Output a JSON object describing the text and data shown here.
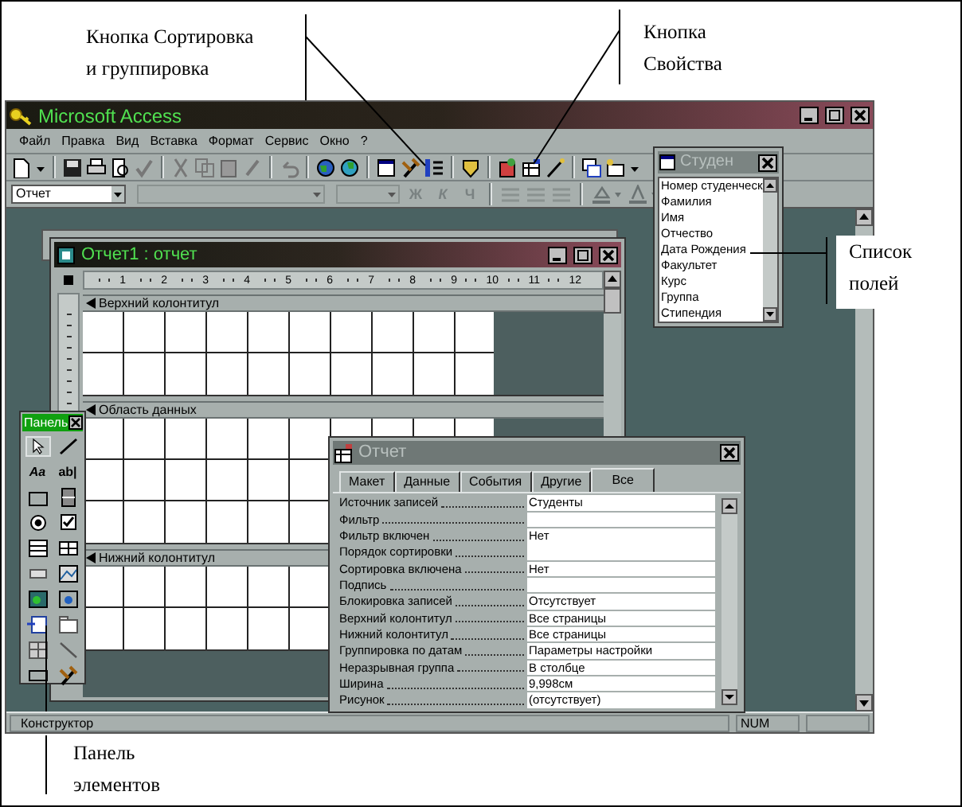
{
  "callouts": [
    {
      "lines": [
        "Кнопка Сортировка",
        "и группировка"
      ]
    },
    {
      "lines": [
        "Кнопка",
        "Свойства"
      ]
    },
    {
      "lines": [
        "Список",
        "полей"
      ]
    },
    {
      "lines": [
        "Панель",
        "элементов"
      ]
    }
  ],
  "app": {
    "title": "Microsoft Access",
    "menu": [
      "Файл",
      "Правка",
      "Вид",
      "Вставка",
      "Формат",
      "Сервис",
      "Окно",
      "?"
    ],
    "object_combo": "Отчет",
    "format_buttons": [
      "Ж",
      "К",
      "Ч"
    ],
    "status": "Конструктор",
    "indicator": "NUM"
  },
  "field_list": {
    "title": "Студен",
    "fields": [
      "Номер студенческ",
      "Фамилия",
      "Имя",
      "Отчество",
      "Дата Рождения",
      "Факультет",
      "Курс",
      "Группа",
      "Стипендия"
    ]
  },
  "report": {
    "title": "Отчет1 : отчет",
    "ruler": [
      "1",
      "2",
      "3",
      "4",
      "5",
      "6",
      "7",
      "8",
      "9",
      "10",
      "11",
      "12"
    ],
    "sections": [
      "Верхний колонтитул",
      "Область данных",
      "Нижний колонтитул"
    ]
  },
  "toolbox": {
    "title": "Панель",
    "text_tools": [
      "Aa",
      "ab|"
    ]
  },
  "properties": {
    "title": "Отчет",
    "tabs": [
      {
        "label": "Макет",
        "selected": false
      },
      {
        "label": "Данные",
        "selected": false
      },
      {
        "label": "События",
        "selected": false
      },
      {
        "label": "Другие",
        "selected": false
      },
      {
        "label": "Все",
        "selected": true
      }
    ],
    "rows": [
      {
        "label": "Источник записей",
        "value": "Студенты"
      },
      {
        "label": "Фильтр",
        "value": ""
      },
      {
        "label": "Фильтр включен",
        "value": "Нет"
      },
      {
        "label": "Порядок сортировки",
        "value": ""
      },
      {
        "label": "Сортировка включена",
        "value": "Нет"
      },
      {
        "label": "Подпись",
        "value": ""
      },
      {
        "label": "Блокировка записей",
        "value": "Отсутствует"
      },
      {
        "label": "Верхний колонтитул",
        "value": "Все страницы"
      },
      {
        "label": "Нижний колонтитул",
        "value": "Все страницы"
      },
      {
        "label": "Группировка по датам",
        "value": "Параметры настройки"
      },
      {
        "label": "Неразрывная группа",
        "value": "В столбце"
      },
      {
        "label": "Ширина",
        "value": "9,998см"
      },
      {
        "label": "Рисунок",
        "value": "(отсутствует)"
      }
    ]
  }
}
